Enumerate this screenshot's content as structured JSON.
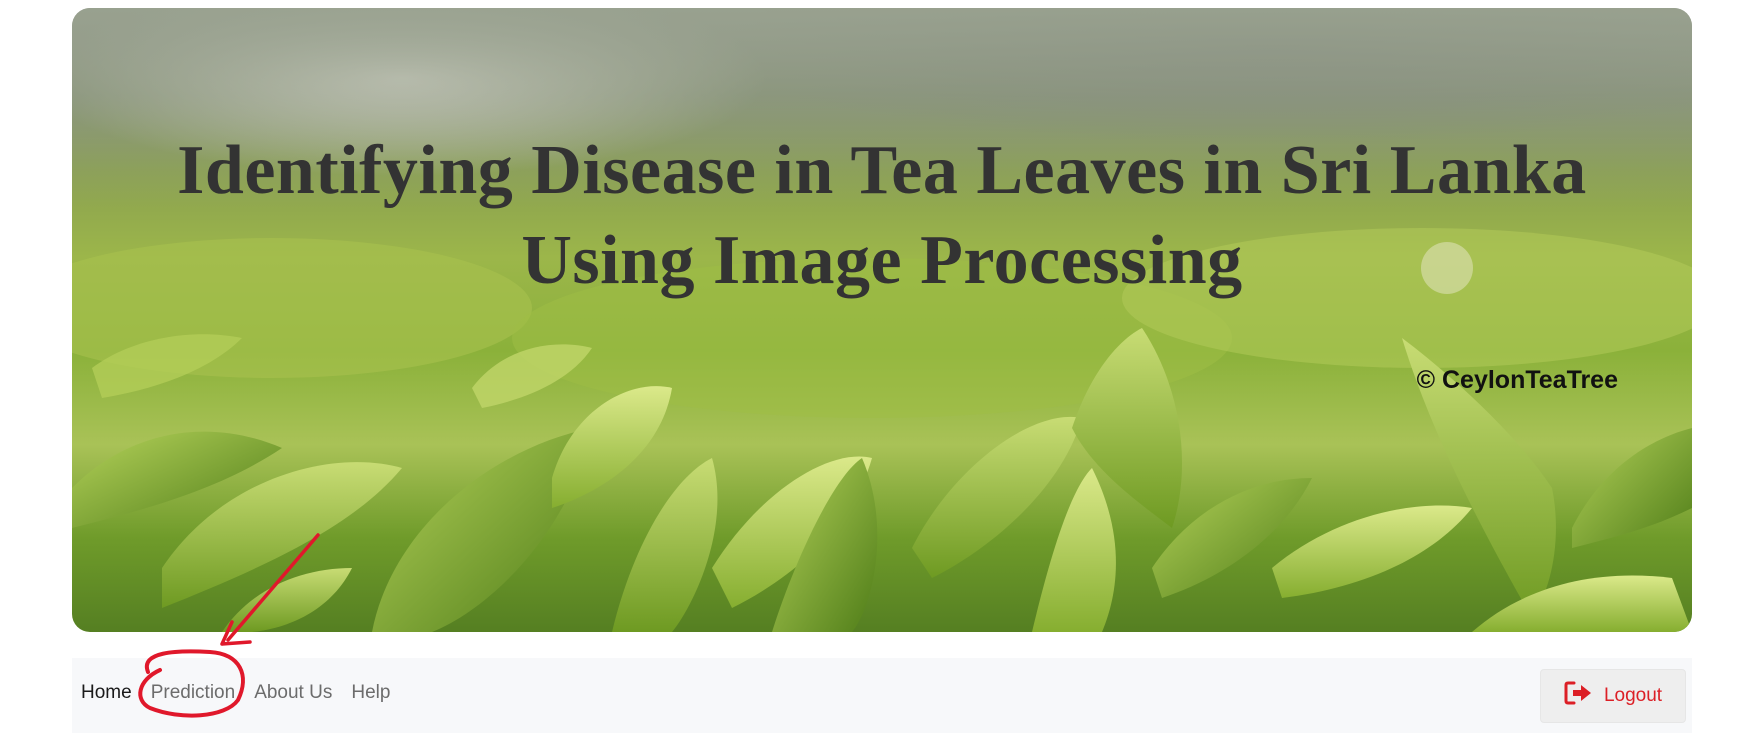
{
  "hero": {
    "title_line1": "Identifying Disease in Tea Leaves in Sri Lanka",
    "title_line2": "Using Image Processing",
    "credit": "© CeylonTeaTree"
  },
  "nav": {
    "items": [
      {
        "label": "Home",
        "active": true
      },
      {
        "label": "Prediction",
        "active": false
      },
      {
        "label": "About Us",
        "active": false
      },
      {
        "label": "Help",
        "active": false
      }
    ],
    "logout_label": "Logout",
    "logout_icon": "sign-out-icon"
  },
  "colors": {
    "accent": "#dc1f26",
    "navbar_bg": "#f7f8fa",
    "annotation": "#e0182b"
  }
}
